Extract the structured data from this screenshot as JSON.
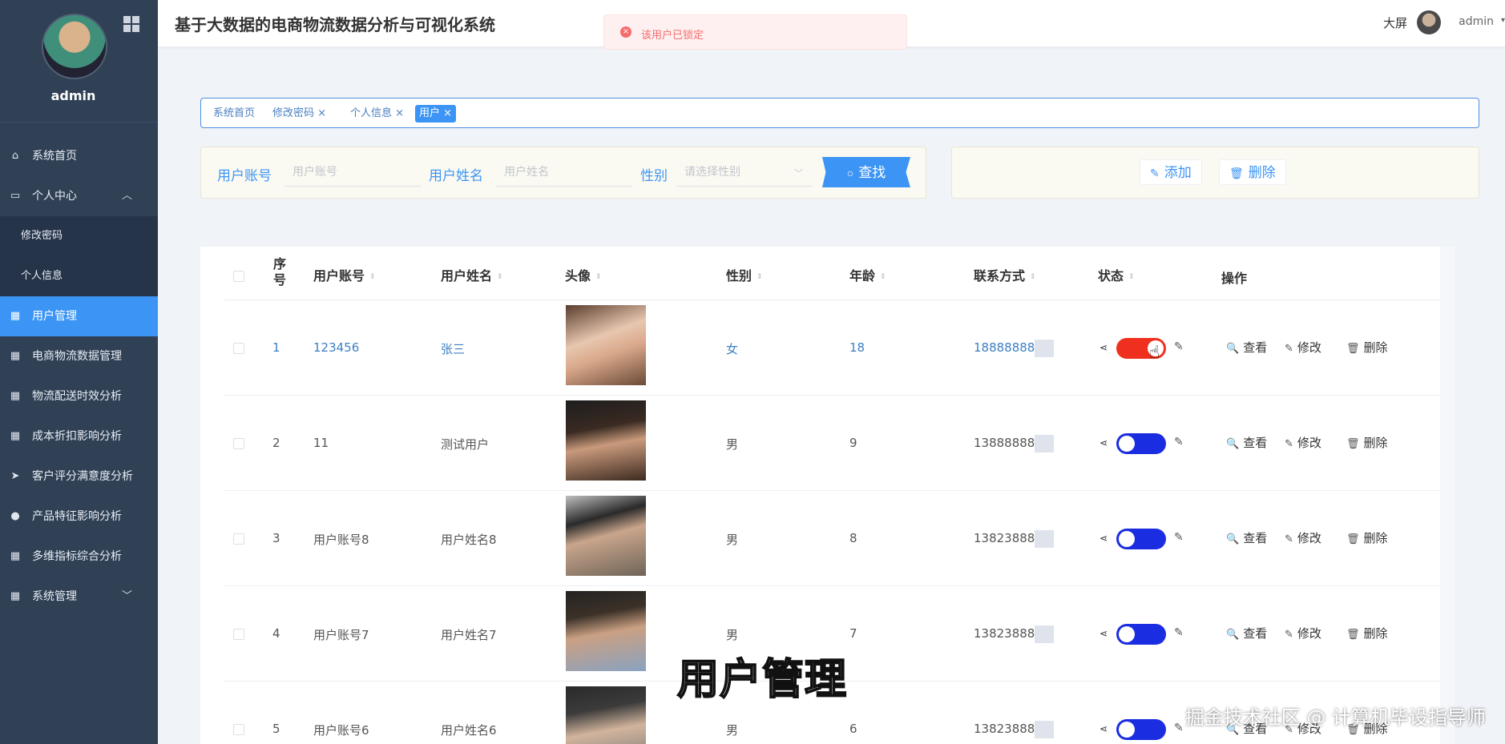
{
  "sidebar": {
    "username": "admin",
    "items": [
      {
        "label": "系统首页",
        "icon": "home-icon"
      },
      {
        "label": "个人中心",
        "icon": "user-center-icon"
      },
      {
        "label": "修改密码",
        "icon": ""
      },
      {
        "label": "个人信息",
        "icon": ""
      },
      {
        "label": "用户管理",
        "icon": "grid-icon"
      },
      {
        "label": "电商物流数据管理",
        "icon": "grid-icon"
      },
      {
        "label": "物流配送时效分析",
        "icon": "grid-icon"
      },
      {
        "label": "成本折扣影响分析",
        "icon": "grid-icon"
      },
      {
        "label": "客户评分满意度分析",
        "icon": "send-icon"
      },
      {
        "label": "产品特征影响分析",
        "icon": "pin-icon"
      },
      {
        "label": "多维指标综合分析",
        "icon": "grid-icon"
      },
      {
        "label": "系统管理",
        "icon": "grid-icon"
      }
    ]
  },
  "header": {
    "title": "基于大数据的电商物流数据分析与可视化系统",
    "big_screen": "大屏",
    "user": "admin"
  },
  "toast": {
    "message": "该用户已锁定",
    "type": "error"
  },
  "tags": [
    {
      "label": "系统首页"
    },
    {
      "label": "修改密码 ×"
    },
    {
      "label": "个人信息 ×"
    },
    {
      "label": "用户 ×"
    }
  ],
  "search": {
    "account_label": "用户账号",
    "account_placeholder": "用户账号",
    "name_label": "用户姓名",
    "name_placeholder": "用户姓名",
    "gender_label": "性别",
    "gender_placeholder": "请选择性别",
    "find_label": "查找"
  },
  "actions": {
    "add_label": "添加",
    "delete_label": "删除"
  },
  "table": {
    "headers": {
      "seq": "序号",
      "account": "用户账号",
      "name": "用户姓名",
      "avatar": "头像",
      "gender": "性别",
      "age": "年龄",
      "contact": "联系方式",
      "status": "状态",
      "ops": "操作"
    },
    "op_labels": {
      "view": "查看",
      "edit": "修改",
      "delete": "删除"
    },
    "rows": [
      {
        "seq": "1",
        "account": "123456",
        "name": "张三",
        "gender": "女",
        "age": "18",
        "contact": "18888888",
        "locked": true
      },
      {
        "seq": "2",
        "account": "11",
        "name": "测试用户",
        "gender": "男",
        "age": "9",
        "contact": "13888888",
        "locked": false
      },
      {
        "seq": "3",
        "account": "用户账号8",
        "name": "用户姓名8",
        "gender": "男",
        "age": "8",
        "contact": "13823888",
        "locked": false
      },
      {
        "seq": "4",
        "account": "用户账号7",
        "name": "用户姓名7",
        "gender": "男",
        "age": "7",
        "contact": "13823888",
        "locked": false
      },
      {
        "seq": "5",
        "account": "用户账号6",
        "name": "用户姓名6",
        "gender": "男",
        "age": "6",
        "contact": "13823888",
        "locked": false
      }
    ]
  },
  "overlay": {
    "subtitle": "用户管理",
    "watermark": "掘金技术社区 @ 计算机毕设指导师"
  },
  "colors": {
    "sidebar_bg": "#304156",
    "accent": "#3c95f5",
    "toggle_on": "#f0301e",
    "toggle_off": "#1a2de0",
    "toast_text": "#f56c6c"
  }
}
